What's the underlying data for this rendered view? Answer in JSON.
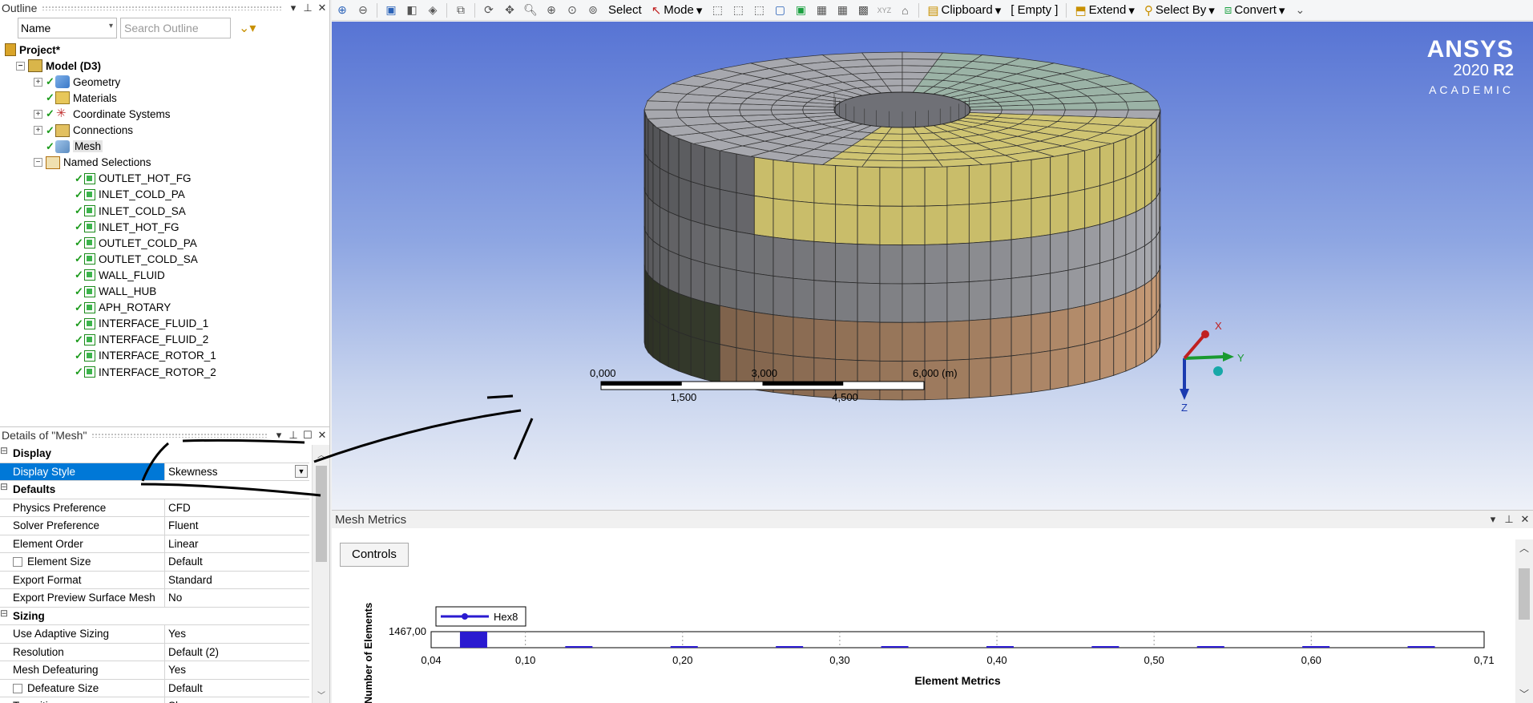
{
  "outline": {
    "title": "Outline",
    "filter_value": "Name",
    "search_placeholder": "Search Outline",
    "tree": [
      {
        "label": "Project*",
        "icon": "project-icon",
        "level": 0,
        "bold": true
      },
      {
        "label": "Model (D3)",
        "icon": "model-icon",
        "level": 1,
        "bold": true,
        "expander": "−"
      },
      {
        "label": "Geometry",
        "icon": "geometry-icon",
        "level": 2,
        "expander": "+",
        "check": true
      },
      {
        "label": "Materials",
        "icon": "materials-icon",
        "level": 2,
        "check": true
      },
      {
        "label": "Coordinate Systems",
        "icon": "coordinate-systems-icon",
        "level": 2,
        "expander": "+",
        "check": true
      },
      {
        "label": "Connections",
        "icon": "connections-icon",
        "level": 2,
        "expander": "+",
        "check": true
      },
      {
        "label": "Mesh",
        "icon": "mesh-icon",
        "level": 2,
        "check": true,
        "highlight": true
      },
      {
        "label": "Named Selections",
        "icon": "named-selections-icon",
        "level": 2,
        "expander": "−"
      },
      {
        "label": "OUTLET_HOT_FG",
        "icon": "named-selection-icon",
        "level": 3,
        "check": true
      },
      {
        "label": "INLET_COLD_PA",
        "icon": "named-selection-icon",
        "level": 3,
        "check": true
      },
      {
        "label": "INLET_COLD_SA",
        "icon": "named-selection-icon",
        "level": 3,
        "check": true
      },
      {
        "label": "INLET_HOT_FG",
        "icon": "named-selection-icon",
        "level": 3,
        "check": true
      },
      {
        "label": "OUTLET_COLD_PA",
        "icon": "named-selection-icon",
        "level": 3,
        "check": true
      },
      {
        "label": "OUTLET_COLD_SA",
        "icon": "named-selection-icon",
        "level": 3,
        "check": true
      },
      {
        "label": "WALL_FLUID",
        "icon": "named-selection-icon",
        "level": 3,
        "check": true
      },
      {
        "label": "WALL_HUB",
        "icon": "named-selection-icon",
        "level": 3,
        "check": true
      },
      {
        "label": "APH_ROTARY",
        "icon": "named-selection-icon",
        "level": 3,
        "check": true
      },
      {
        "label": "INTERFACE_FLUID_1",
        "icon": "named-selection-icon",
        "level": 3,
        "check": true
      },
      {
        "label": "INTERFACE_FLUID_2",
        "icon": "named-selection-icon",
        "level": 3,
        "check": true
      },
      {
        "label": "INTERFACE_ROTOR_1",
        "icon": "named-selection-icon",
        "level": 3,
        "check": true
      },
      {
        "label": "INTERFACE_ROTOR_2",
        "icon": "named-selection-icon",
        "level": 3,
        "check": true
      }
    ]
  },
  "details": {
    "title": "Details of \"Mesh\"",
    "rows": [
      {
        "type": "category",
        "label": "Display"
      },
      {
        "type": "prop",
        "key": "Display Style",
        "value": "Skewness",
        "selected": true,
        "dropdown": true
      },
      {
        "type": "category",
        "label": "Defaults"
      },
      {
        "type": "prop",
        "key": "Physics Preference",
        "value": "CFD"
      },
      {
        "type": "prop",
        "key": "Solver Preference",
        "value": "Fluent"
      },
      {
        "type": "prop",
        "key": "Element Order",
        "value": "Linear"
      },
      {
        "type": "prop",
        "key": "Element Size",
        "value": "Default",
        "checkbox": true
      },
      {
        "type": "prop",
        "key": "Export Format",
        "value": "Standard"
      },
      {
        "type": "prop",
        "key": "Export Preview Surface Mesh",
        "value": "No"
      },
      {
        "type": "category",
        "label": "Sizing"
      },
      {
        "type": "prop",
        "key": "Use Adaptive Sizing",
        "value": "Yes"
      },
      {
        "type": "prop",
        "key": "Resolution",
        "value": "Default (2)"
      },
      {
        "type": "prop",
        "key": "Mesh Defeaturing",
        "value": "Yes"
      },
      {
        "type": "prop",
        "key": "Defeature Size",
        "value": "Default",
        "checkbox": true
      },
      {
        "type": "prop",
        "key": "Transition",
        "value": "Slow"
      }
    ]
  },
  "toolbar": {
    "select_label": "Select",
    "mode_label": "Mode",
    "clipboard_label": "Clipboard",
    "empty_label": "[ Empty ]",
    "extend_label": "Extend",
    "select_by_label": "Select By",
    "convert_label": "Convert",
    "xyz_label": "XYZ"
  },
  "viewport": {
    "logo_brand": "ANSYS",
    "logo_version_year": "2020",
    "logo_version_release": "R2",
    "logo_edition": "ACADEMIC",
    "scale_labels_top": [
      "0,000",
      "3,000",
      "6,000 (m)"
    ],
    "scale_labels_bottom": [
      "1,500",
      "4,500"
    ],
    "triad": {
      "x": "X",
      "y": "Y",
      "z": "Z"
    }
  },
  "metrics": {
    "title": "Mesh Metrics",
    "controls_label": "Controls",
    "legend_label": "Hex8",
    "colors": {
      "bar": "#2a1ad0"
    }
  },
  "chart_data": {
    "type": "bar",
    "title": "",
    "xlabel": "Element Metrics",
    "ylabel": "Number of Elements",
    "xlim": [
      0.04,
      0.71
    ],
    "ylim": [
      0,
      1467
    ],
    "y_tick_label": "1467,00",
    "x_tick_labels": [
      "0,04",
      "0,10",
      "0,20",
      "0,30",
      "0,40",
      "0,50",
      "0,60",
      "0,71"
    ],
    "x_tick_values": [
      0.04,
      0.1,
      0.2,
      0.3,
      0.4,
      0.5,
      0.6,
      0.71
    ],
    "series": [
      {
        "name": "Hex8",
        "x": [
          0.067,
          0.134,
          0.201,
          0.268,
          0.335,
          0.402,
          0.469,
          0.536,
          0.603,
          0.67
        ],
        "values": [
          1467,
          140,
          140,
          140,
          60,
          140,
          60,
          60,
          60,
          60
        ]
      }
    ]
  }
}
